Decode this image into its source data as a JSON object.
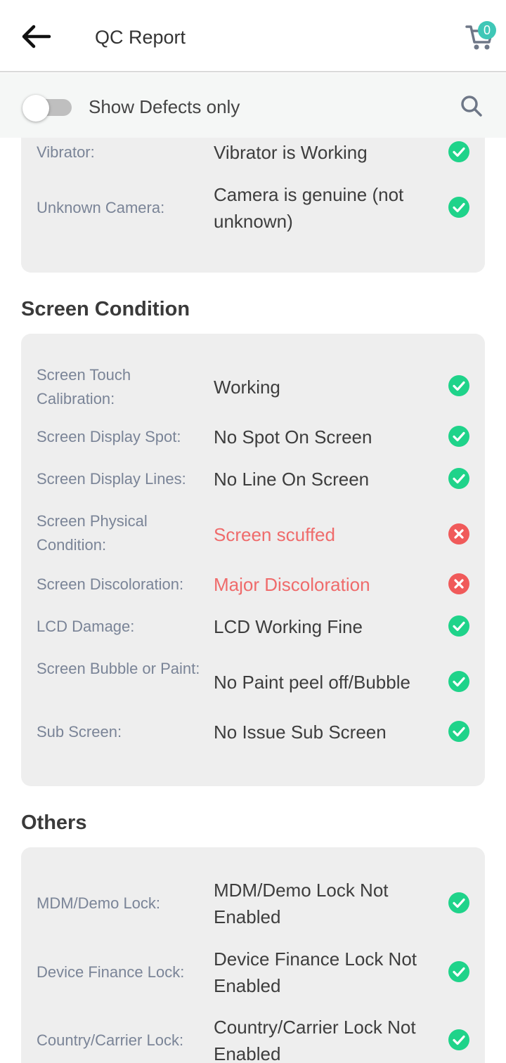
{
  "header": {
    "title": "QC Report",
    "cart_count": "0"
  },
  "filter": {
    "label": "Show Defects only"
  },
  "colors": {
    "pass": "#1fd38a",
    "fail": "#f05a5a",
    "accent": "#3fc7b7"
  },
  "sections": [
    {
      "title": "",
      "rows": [
        {
          "label": "Vibrator:",
          "value": "Vibrator is Working",
          "status": "pass"
        },
        {
          "label": "Unknown Camera:",
          "value": "Camera is genuine (not unknown)",
          "status": "pass"
        }
      ]
    },
    {
      "title": "Screen Condition",
      "rows": [
        {
          "label": "Screen Touch Calibration:",
          "value": "Working",
          "status": "pass"
        },
        {
          "label": "Screen Display Spot:",
          "value": "No Spot On Screen",
          "status": "pass"
        },
        {
          "label": "Screen Display Lines:",
          "value": "No Line On Screen",
          "status": "pass"
        },
        {
          "label": "Screen Physical Condition:",
          "value": "Screen scuffed",
          "status": "fail"
        },
        {
          "label": "Screen Discoloration:",
          "value": "Major Discoloration",
          "status": "fail"
        },
        {
          "label": "LCD Damage:",
          "value": "LCD Working Fine",
          "status": "pass"
        },
        {
          "label": "Screen Bubble or Paint:",
          "value": "No Paint peel off/Bubble",
          "status": "pass"
        },
        {
          "label": "Sub Screen:",
          "value": "No Issue Sub Screen",
          "status": "pass"
        }
      ]
    },
    {
      "title": "Others",
      "rows": [
        {
          "label": "MDM/Demo Lock:",
          "value": "MDM/Demo Lock Not Enabled",
          "status": "pass"
        },
        {
          "label": "Device Finance Lock:",
          "value": "Device Finance Lock Not Enabled",
          "status": "pass"
        },
        {
          "label": "Country/Carrier Lock:",
          "value": "Country/Carrier Lock Not Enabled",
          "status": "pass"
        }
      ]
    }
  ]
}
